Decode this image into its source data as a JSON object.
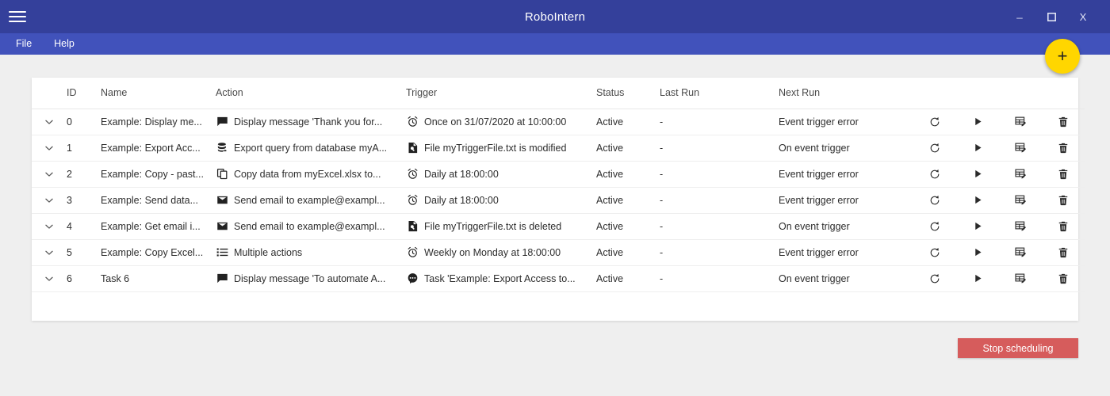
{
  "window": {
    "title": "RoboIntern",
    "menu_icon": "hamburger-icon",
    "minimize_label": "_",
    "maximize_label": "□",
    "close_label": "X"
  },
  "menubar": {
    "items": [
      {
        "label": "File"
      },
      {
        "label": "Help"
      }
    ]
  },
  "fab": {
    "label": "+",
    "color": "#ffd600",
    "name": "add-task-button"
  },
  "table": {
    "columns": [
      "",
      "ID",
      "Name",
      "Action",
      "Trigger",
      "Status",
      "Last Run",
      "Next Run"
    ],
    "rows": [
      {
        "id": "0",
        "name": "Example: Display me...",
        "action_icon": "message-icon",
        "action": "Display message 'Thank you for...",
        "trigger_icon": "alarm-clock-icon",
        "trigger": "Once on 31/07/2020 at 10:00:00",
        "status": "Active",
        "last_run": "-",
        "next_run": "Event trigger error"
      },
      {
        "id": "1",
        "name": "Example: Export Acc...",
        "action_icon": "database-icon",
        "action": "Export query from database myA...",
        "trigger_icon": "file-document-icon",
        "trigger": "File myTriggerFile.txt is modified",
        "status": "Active",
        "last_run": "-",
        "next_run": "On event trigger"
      },
      {
        "id": "2",
        "name": "Example: Copy - past...",
        "action_icon": "copy-icon",
        "action": "Copy data from myExcel.xlsx to...",
        "trigger_icon": "alarm-clock-icon",
        "trigger": "Daily at 18:00:00",
        "status": "Active",
        "last_run": "-",
        "next_run": "Event trigger error"
      },
      {
        "id": "3",
        "name": "Example: Send data...",
        "action_icon": "email-icon",
        "action": "Send email to example@exampl...",
        "trigger_icon": "alarm-clock-icon",
        "trigger": "Daily at 18:00:00",
        "status": "Active",
        "last_run": "-",
        "next_run": "Event trigger error"
      },
      {
        "id": "4",
        "name": "Example: Get email i...",
        "action_icon": "email-icon",
        "action": "Send email to example@exampl...",
        "trigger_icon": "file-document-icon",
        "trigger": "File myTriggerFile.txt is deleted",
        "status": "Active",
        "last_run": "-",
        "next_run": "On event trigger"
      },
      {
        "id": "5",
        "name": "Example: Copy Excel...",
        "action_icon": "list-icon",
        "action": "Multiple actions",
        "trigger_icon": "alarm-clock-icon",
        "trigger": "Weekly on Monday at 18:00:00",
        "status": "Active",
        "last_run": "-",
        "next_run": "Event trigger error"
      },
      {
        "id": "6",
        "name": "Task 6",
        "action_icon": "message-icon",
        "action": "Display message 'To automate A...",
        "trigger_icon": "task-bubble-icon",
        "trigger": "Task 'Example: Export Access to...",
        "status": "Active",
        "last_run": "-",
        "next_run": "On event trigger"
      }
    ],
    "row_actions": [
      {
        "name": "refresh-icon",
        "title": "Refresh"
      },
      {
        "name": "play-icon",
        "title": "Run"
      },
      {
        "name": "edit-table-icon",
        "title": "Edit"
      },
      {
        "name": "delete-icon",
        "title": "Delete"
      }
    ]
  },
  "footer": {
    "stop_scheduling_label": "Stop scheduling",
    "stop_scheduling_color": "#d65c5c"
  }
}
